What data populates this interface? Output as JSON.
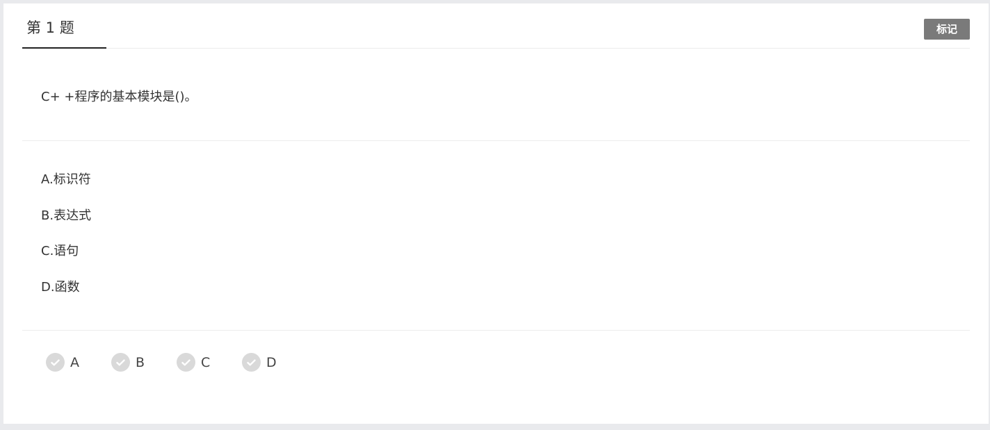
{
  "header": {
    "title": "第 1 题",
    "mark_label": "标记"
  },
  "question": {
    "text": "C+ +程序的基本模块是()。"
  },
  "options": [
    {
      "text": "A.标识符"
    },
    {
      "text": "B.表达式"
    },
    {
      "text": "C.语句"
    },
    {
      "text": "D.函数"
    }
  ],
  "answers": [
    {
      "label": "A",
      "icon": "check-circle-icon"
    },
    {
      "label": "B",
      "icon": "check-circle-icon"
    },
    {
      "label": "C",
      "icon": "check-circle-icon"
    },
    {
      "label": "D",
      "icon": "check-circle-icon"
    }
  ],
  "colors": {
    "mark_button_bg": "#7a7a7a",
    "check_circle_bg": "#d9d9d9",
    "tab_underline": "#222222"
  }
}
